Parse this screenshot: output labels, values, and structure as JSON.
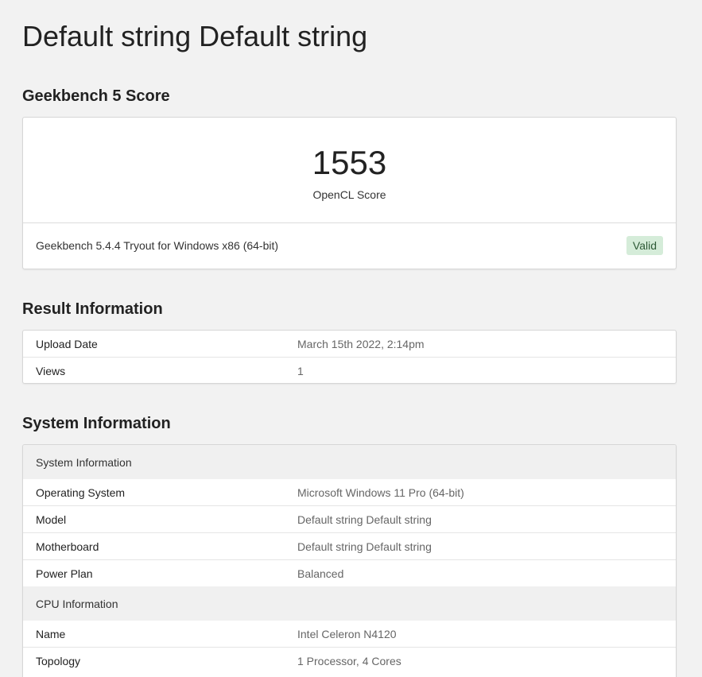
{
  "page": {
    "title": "Default string Default string"
  },
  "score_section": {
    "heading": "Geekbench 5 Score",
    "score": "1553",
    "score_label": "OpenCL Score",
    "version": "Geekbench 5.4.4 Tryout for Windows x86 (64-bit)",
    "status": "Valid",
    "status_color": "#d5ecd9"
  },
  "result_section": {
    "heading": "Result Information",
    "rows": [
      {
        "key": "Upload Date",
        "value": "March 15th 2022, 2:14pm"
      },
      {
        "key": "Views",
        "value": "1"
      }
    ]
  },
  "system_section": {
    "heading": "System Information",
    "groups": [
      {
        "title": "System Information",
        "rows": [
          {
            "key": "Operating System",
            "value": "Microsoft Windows 11 Pro (64-bit)"
          },
          {
            "key": "Model",
            "value": "Default string Default string"
          },
          {
            "key": "Motherboard",
            "value": "Default string Default string"
          },
          {
            "key": "Power Plan",
            "value": "Balanced"
          }
        ]
      },
      {
        "title": "CPU Information",
        "rows": [
          {
            "key": "Name",
            "value": "Intel Celeron N4120"
          },
          {
            "key": "Topology",
            "value": "1 Processor, 4 Cores"
          }
        ]
      }
    ]
  }
}
